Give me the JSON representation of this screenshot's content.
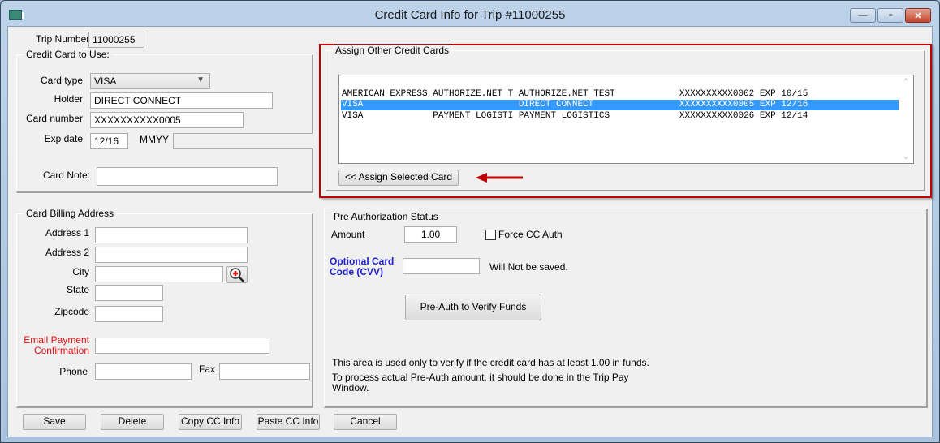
{
  "window": {
    "title": "Credit Card Info for Trip #11000255",
    "icon": "app-icon",
    "controls": {
      "minimize": "—",
      "maximize": "▫",
      "close": "✕"
    }
  },
  "trip": {
    "label": "Trip Number",
    "value": "11000255"
  },
  "credit_card": {
    "group_label": "Credit Card to Use:",
    "card_type_label": "Card type",
    "card_type_value": "VISA",
    "holder_label": "Holder",
    "holder_value": "DIRECT CONNECT",
    "card_number_label": "Card number",
    "card_number_value": "XXXXXXXXXX0005",
    "exp_date_label": "Exp date",
    "exp_date_value": "12/16",
    "exp_format_label": "MMYY",
    "exp_extra_value": "",
    "card_note_label": "Card Note:",
    "card_note_value": ""
  },
  "assign": {
    "group_label": "Assign Other Credit Cards",
    "rows": [
      {
        "text": "AMERICAN EXPRESS AUTHORIZE.NET T AUTHORIZE.NET TEST            XXXXXXXXXX0002 EXP 10/15",
        "selected": false
      },
      {
        "text": "VISA                             DIRECT CONNECT                XXXXXXXXXX0005 EXP 12/16",
        "selected": true
      },
      {
        "text": "VISA             PAYMENT LOGISTI PAYMENT LOGISTICS             XXXXXXXXXX0026 EXP 12/14",
        "selected": false
      }
    ],
    "assign_button": "<< Assign Selected Card",
    "highlight_color": "#c00000",
    "selection_color": "#3399ff"
  },
  "billing": {
    "group_label": "Card Billing Address",
    "address1_label": "Address 1",
    "address1_value": "",
    "address2_label": "Address 2",
    "address2_value": "",
    "city_label": "City",
    "city_value": "",
    "state_label": "State",
    "state_value": "",
    "zip_label": "Zipcode",
    "zip_value": "",
    "email_label_1": "Email Payment",
    "email_label_2": "Confirmation",
    "email_value": "",
    "phone_label": "Phone",
    "phone_value": "",
    "fax_label": "Fax",
    "fax_value": ""
  },
  "preauth": {
    "group_label": "Pre Authorization Status",
    "amount_label": "Amount",
    "amount_value": "1.00",
    "force_label": "Force CC Auth",
    "force_checked": false,
    "cvv_label_1": "Optional Card",
    "cvv_label_2": "Code (CVV)",
    "cvv_value": "",
    "cvv_note": "Will Not be saved.",
    "verify_button": "Pre-Auth to Verify Funds",
    "info_line1": "This area is used only to verify if the credit card has at least 1.00 in funds.",
    "info_line2": "To process actual Pre-Auth amount, it should be done in the Trip Pay",
    "info_line3": "Window."
  },
  "footer": {
    "save": "Save",
    "delete": "Delete",
    "copy": "Copy CC Info",
    "paste": "Paste CC Info",
    "cancel": "Cancel"
  }
}
